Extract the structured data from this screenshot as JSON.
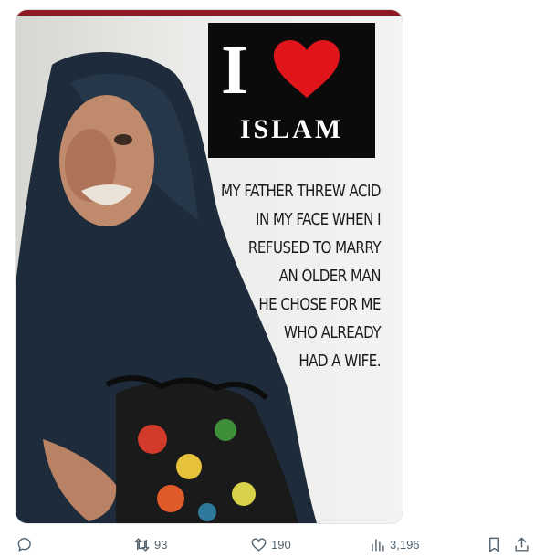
{
  "media": {
    "badge": {
      "letter": "I",
      "word": "ISLAM",
      "heart_color": "#e0151b",
      "icon": "heart-icon"
    },
    "caption_lines": [
      "My father threw acid",
      "in my face when I",
      "refused to marry",
      "an older man",
      "he chose for me",
      "who already",
      "had a wife."
    ]
  },
  "actions": {
    "reply": {
      "icon": "reply-icon"
    },
    "repost": {
      "icon": "repost-icon",
      "count": "93"
    },
    "like": {
      "icon": "heart-outline-icon",
      "count": "190"
    },
    "views": {
      "icon": "views-icon",
      "count": "3,196"
    },
    "bookmark": {
      "icon": "bookmark-icon"
    },
    "share": {
      "icon": "share-icon"
    }
  },
  "colors": {
    "action_gray": "#536471",
    "strip": "#8e1b24"
  }
}
